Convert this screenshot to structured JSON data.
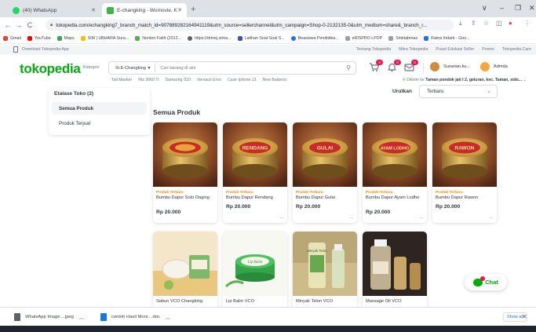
{
  "browser": {
    "tabs": [
      {
        "title": "(40) WhatsApp",
        "favicon_color": "#25d366"
      },
      {
        "title": "E-changking - Womovie, Kota",
        "favicon_color": "#42b549"
      }
    ],
    "new_tab": "+",
    "window_controls": [
      "∨",
      "–",
      "❐",
      "✕"
    ],
    "url": "tokopedia.com/echangking7_branch_match_id=907889282164941119&utm_source=sellerchannel&utm_campaign=Shop-0-2132135-0&utm_medium=share&_branch_r...",
    "bookmarks": [
      {
        "label": "Gmail",
        "color": "#ea4335"
      },
      {
        "label": "YouTube",
        "color": "#ff0000"
      },
      {
        "label": "Maps",
        "color": "#34a853"
      },
      {
        "label": "SIM | UBHARA Sura...",
        "color": "#fbbc04"
      },
      {
        "label": "Nonton Fatih (2012...",
        "color": "#4caf50"
      },
      {
        "label": "https://drmej.stma...",
        "color": "#5f6368"
      },
      {
        "label": "Latihan Soal-Soal S...",
        "color": "#3f51b5"
      },
      {
        "label": "Beasiswa Pendidika...",
        "color": "#1a73e8"
      },
      {
        "label": "eRISPRO LPDP",
        "color": "#9aa0a6"
      },
      {
        "label": "Smktabmas",
        "color": "#9aa0a6"
      },
      {
        "label": "Ratna Indarti - Goo...",
        "color": "#1a73e8"
      }
    ]
  },
  "tokopedia": {
    "download_app": "Download Tokopedia App",
    "top_links": [
      "Tentang Tokopedia",
      "Mitra Tokopedia",
      "Pusat Edukasi Seller",
      "Promo",
      "Tokopedia Care"
    ],
    "logo": "tokopedia",
    "kategori": "Kategori",
    "search_scope": "Si E-Changking",
    "search_placeholder": "Cari barang di sini",
    "cart_badge": "4",
    "notif_badge": "8",
    "msg_badge": "8",
    "shop_name": "Susanan.ku...",
    "user_name": "Admda",
    "quick_links": [
      "Tali Masker",
      "Rtx 3060 Ti",
      "Samsung S10",
      "Versace Eros",
      "Case Iphone 13",
      "New Balance"
    ],
    "location_prefix": "Dikirim ke",
    "location_value": "Taman pondok jati I 2, geluran, kec. Taman, sido..."
  },
  "sidebar": {
    "title": "Etalase Toko (2)",
    "items": [
      {
        "label": "Semua Produk",
        "active": true
      },
      {
        "label": "Produk Terjual",
        "active": false
      }
    ]
  },
  "sort": {
    "label": "Urutkan",
    "value": "Terbaru"
  },
  "section_title": "Semua Produk",
  "products": [
    {
      "label": "Produk Terbaru",
      "name": "Bumbu Dapur Soto Daging",
      "price": "Rp 20.000",
      "lid_text": ""
    },
    {
      "label": "Produk Terbaru",
      "name": "Bumbu Dapur Rendang",
      "price": "Rp 20.000",
      "lid_text": "RENDANG"
    },
    {
      "label": "Produk Terbaru",
      "name": "Bumbu Dapur Gulai",
      "price": "Rp 20.000",
      "lid_text": "GULAI"
    },
    {
      "label": "Produk Terbaru",
      "name": "Bumbu Dapur Ayam Lodho",
      "price": "Rp 20.000",
      "lid_text": "AYAM LODHO"
    },
    {
      "label": "Produk Terbaru",
      "name": "Bumbu Dapur Rawon",
      "price": "Rp 20.000",
      "lid_text": "RAWON"
    }
  ],
  "products_row2": [
    {
      "name": "Sabun VCO Changking"
    },
    {
      "name": "Lip Balm VCO",
      "lid_text": "Lip Balm"
    },
    {
      "name": "Minyak Telon VCO",
      "lid_text": "Minyak Telon"
    },
    {
      "name": "Massage Oil VCO"
    }
  ],
  "chat": "Chat",
  "downloads": {
    "items": [
      {
        "name": "WhatsApp Image....jpeg",
        "color": "#5f6368"
      },
      {
        "name": "contoh Hasil Moni....doc",
        "color": "#1a73e8"
      }
    ],
    "show_all": "Show all",
    "close": "✕"
  }
}
